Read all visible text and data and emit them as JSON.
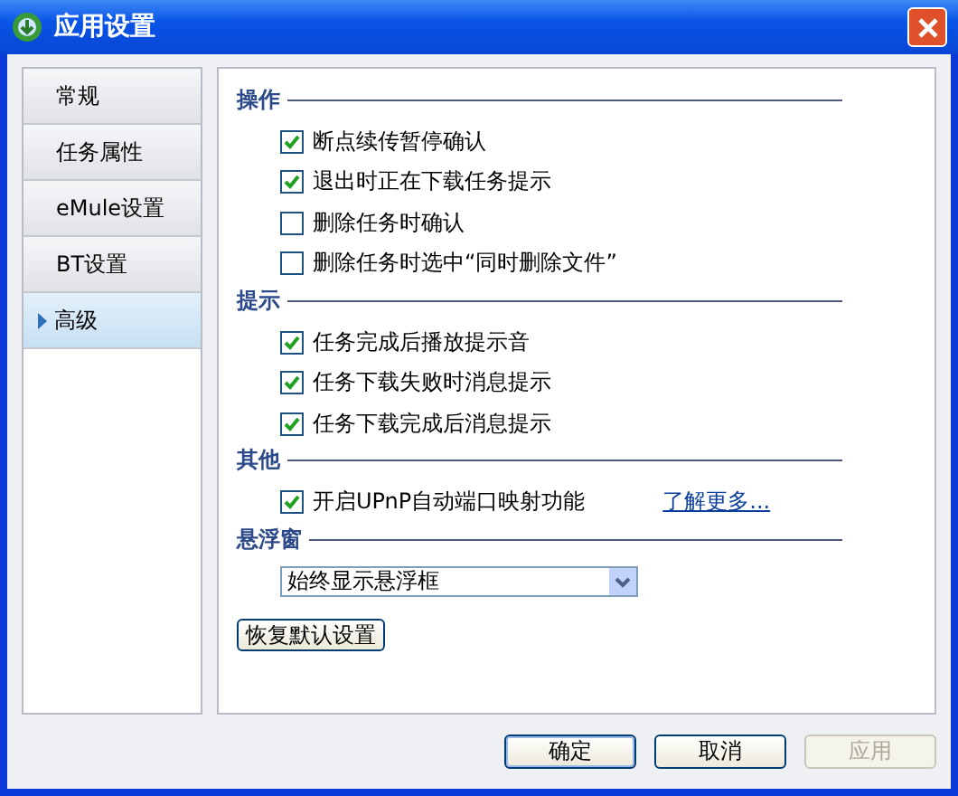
{
  "window": {
    "title": "应用设置"
  },
  "sidebar": {
    "items": [
      {
        "label": "常规",
        "selected": false
      },
      {
        "label": "任务属性",
        "selected": false
      },
      {
        "label": "eMule设置",
        "selected": false
      },
      {
        "label": "BT设置",
        "selected": false
      },
      {
        "label": "高级",
        "selected": true
      }
    ]
  },
  "sections": [
    {
      "title": "操作",
      "items": [
        {
          "kind": "checkbox",
          "label": "断点续传暂停确认",
          "checked": true
        },
        {
          "kind": "checkbox",
          "label": "退出时正在下载任务提示",
          "checked": true
        },
        {
          "kind": "checkbox",
          "label": "删除任务时确认",
          "checked": false
        },
        {
          "kind": "checkbox",
          "label": "删除任务时选中“同时删除文件”",
          "checked": false
        }
      ]
    },
    {
      "title": "提示",
      "items": [
        {
          "kind": "checkbox",
          "label": "任务完成后播放提示音",
          "checked": true
        },
        {
          "kind": "checkbox",
          "label": "任务下载失败时消息提示",
          "checked": true
        },
        {
          "kind": "checkbox",
          "label": "任务下载完成后消息提示",
          "checked": true
        }
      ]
    },
    {
      "title": "其他",
      "items": [
        {
          "kind": "checkbox",
          "label": "开启UPnP自动端口映射功能",
          "checked": true,
          "link": "了解更多..."
        }
      ]
    },
    {
      "title": "悬浮窗",
      "items": [
        {
          "kind": "dropdown",
          "value": "始终显示悬浮框"
        }
      ]
    }
  ],
  "restore_button": "恢复默认设置",
  "buttons": [
    {
      "label": "确定",
      "disabled": false,
      "default": true
    },
    {
      "label": "取消",
      "disabled": false,
      "default": false
    },
    {
      "label": "应用",
      "disabled": true,
      "default": false
    }
  ]
}
